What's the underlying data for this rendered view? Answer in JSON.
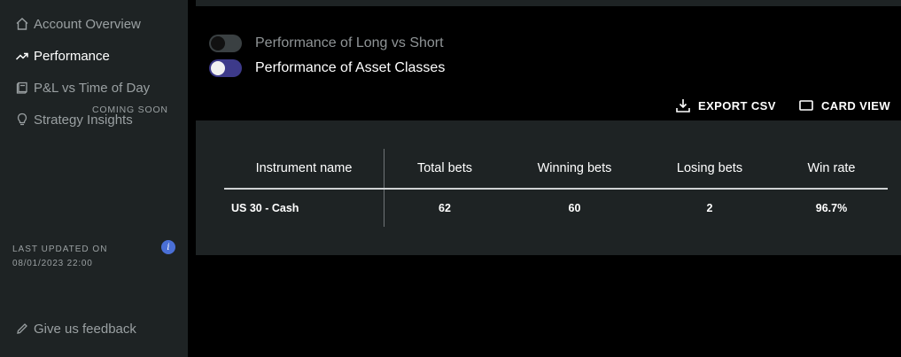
{
  "sidebar": {
    "items": [
      {
        "label": "Account Overview",
        "icon": "home-icon",
        "active": false
      },
      {
        "label": "Performance",
        "icon": "trending-up-icon",
        "active": true
      },
      {
        "label": "P&L vs Time of Day",
        "icon": "book-icon",
        "active": false
      },
      {
        "label": "Strategy Insights",
        "icon": "lightbulb-icon",
        "active": false
      }
    ],
    "coming_soon": "COMING SOON",
    "last_updated_label": "LAST UPDATED ON",
    "last_updated_value": "08/01/2023 22:00",
    "info_icon_glyph": "i",
    "feedback_label": "Give us feedback"
  },
  "toggles": [
    {
      "label": "Performance of Long vs Short",
      "on": false
    },
    {
      "label": "Performance of Asset Classes",
      "on": true
    }
  ],
  "actions": {
    "export_label": "EXPORT CSV",
    "card_view_label": "CARD VIEW"
  },
  "table": {
    "headers": [
      "Instrument name",
      "Total bets",
      "Winning bets",
      "Losing bets",
      "Win rate"
    ],
    "rows": [
      [
        "US 30 - Cash",
        "62",
        "60",
        "2",
        "96.7%"
      ]
    ]
  },
  "colors": {
    "background": "#000000",
    "panel": "#1e2324",
    "accent_toggle": "#3d3a8a",
    "info_badge": "#4a6fd6"
  }
}
